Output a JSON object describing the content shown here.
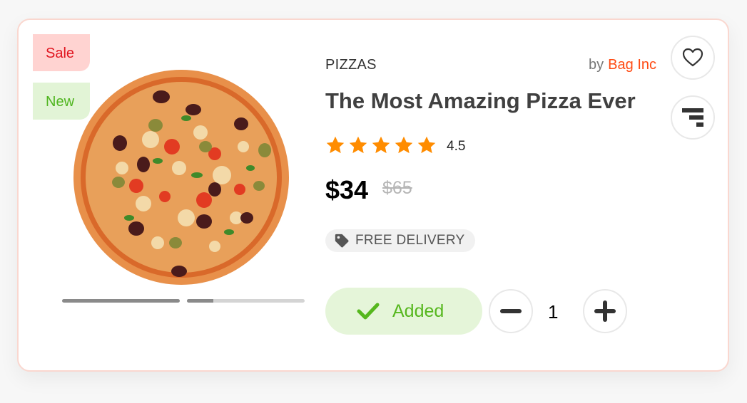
{
  "product": {
    "badges": {
      "sale": "Sale",
      "new": "New"
    },
    "category": "PIZZAS",
    "by_prefix": "by",
    "brand": "Bag Inc",
    "title": "The Most Amazing Pizza Ever",
    "rating": "4.5",
    "rating_stars": 5,
    "price": "$34",
    "old_price": "$65",
    "delivery_label": "FREE DELIVERY",
    "image_slider": {
      "slides": 2,
      "active": 1
    }
  },
  "cart": {
    "added_label": "Added",
    "quantity": "1"
  },
  "colors": {
    "accent": "#ff4a12",
    "star": "#ff8c00",
    "success": "#56b71e",
    "sale": "#e0151f"
  },
  "icons": [
    "heart-icon",
    "compare-icon",
    "star-icon",
    "tag-icon",
    "check-icon",
    "minus-icon",
    "plus-icon"
  ]
}
